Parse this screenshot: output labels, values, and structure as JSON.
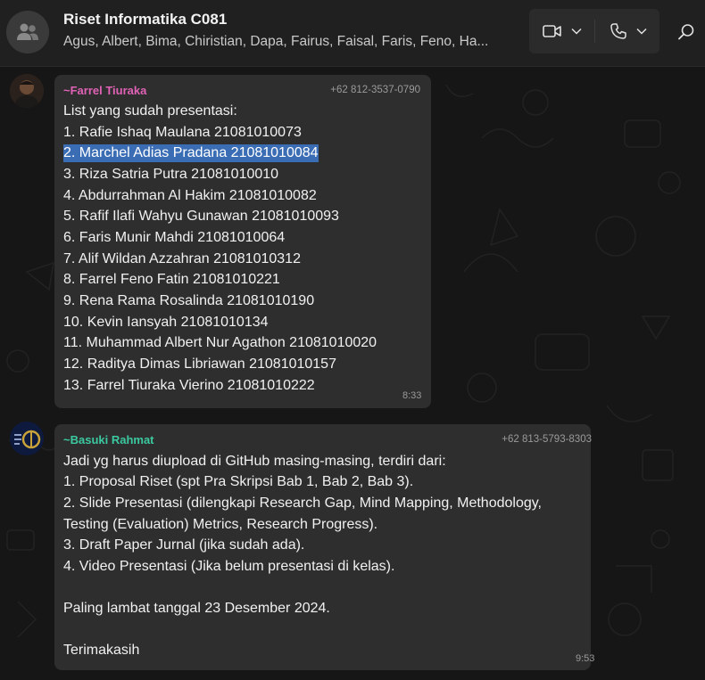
{
  "header": {
    "title": "Riset Informatika C081",
    "members": "Agus, Albert, Bima, Chiristian, Dapa, Fairus, Faisal, Faris, Feno, Ha..."
  },
  "messages": [
    {
      "sender": "~Farrel Tiuraka",
      "phone": "+62 812-3537-0790",
      "sender_color": "#e062b5",
      "lines": [
        "List yang sudah presentasi:",
        "1. Rafie Ishaq Maulana 21081010073",
        "2. Marchel Adias Pradana 21081010084",
        "3. Riza Satria Putra 21081010010",
        "4. Abdurrahman Al Hakim 21081010082",
        "5. Rafif Ilafi Wahyu Gunawan 21081010093",
        "6. Faris Munir Mahdi 21081010064",
        "7. Alif Wildan Azzahran 21081010312",
        "8. Farrel Feno Fatin 21081010221",
        "9. Rena Rama Rosalinda 21081010190",
        "10. Kevin Iansyah 21081010134",
        "11. Muhammad Albert Nur Agathon 21081010020",
        "12. Raditya Dimas Libriawan 21081010157",
        "13. Farrel Tiuraka Vierino 21081010222"
      ],
      "time": "8:33"
    },
    {
      "sender": "~Basuki Rahmat",
      "phone": "+62 813-5793-8303",
      "sender_color": "#3bc9a0",
      "lines": [
        "Jadi yg harus diupload di GitHub masing-masing, terdiri dari:",
        "1. Proposal Riset (spt Pra Skripsi Bab 1, Bab 2, Bab 3).",
        "2. Slide Presentasi (dilengkapi Research Gap, Mind Mapping, Methodology,",
        "Testing (Evaluation) Metrics, Research Progress).",
        "3. Draft Paper Jurnal (jika sudah ada).",
        "4. Video Presentasi (Jika belum presentasi di kelas).",
        "",
        "Paling lambat tanggal 23 Desember 2024.",
        "",
        "Terimakasih"
      ],
      "time": "9:53"
    }
  ],
  "colors": {
    "selection": "#3b6db5",
    "bubble": "#2e2e2e",
    "header_bg": "#202020"
  }
}
